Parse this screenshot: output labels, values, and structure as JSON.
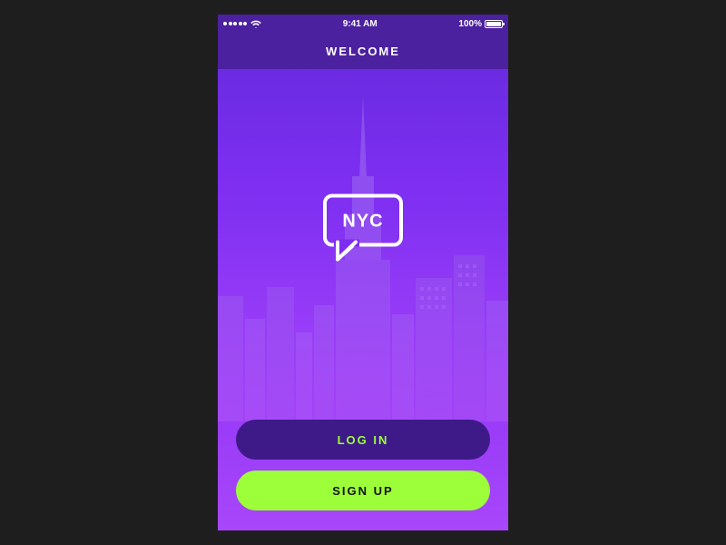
{
  "status": {
    "time": "9:41 AM",
    "battery_pct": "100%"
  },
  "nav": {
    "title": "WELCOME"
  },
  "logo": {
    "text": "NYC"
  },
  "buttons": {
    "login": "LOG IN",
    "signup": "SIGN UP"
  },
  "colors": {
    "accent_green": "#9cff3a",
    "deep_purple": "#3d1a88",
    "nav_purple": "#4b219f",
    "bg_page": "#1e1e1e"
  }
}
